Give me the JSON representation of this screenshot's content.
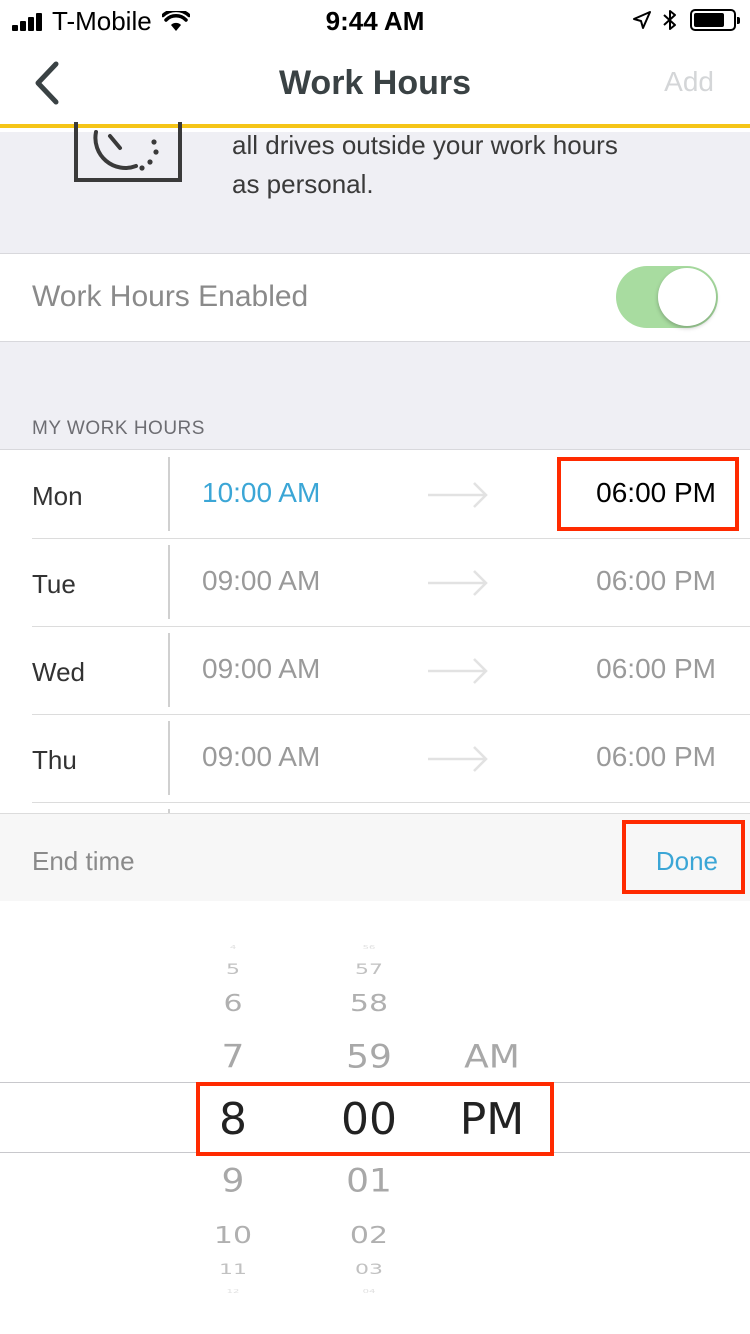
{
  "status_bar": {
    "carrier": "T-Mobile",
    "time": "9:44 AM"
  },
  "nav": {
    "title": "Work Hours",
    "add_label": "Add"
  },
  "intro": {
    "line1": "all drives outside your work hours",
    "line2": "as personal."
  },
  "toggle": {
    "label": "Work Hours Enabled",
    "enabled": true
  },
  "section": {
    "header": "MY WORK HOURS"
  },
  "days": [
    {
      "name": "Mon",
      "start": "10:00 AM",
      "end": "06:00 PM"
    },
    {
      "name": "Tue",
      "start": "09:00 AM",
      "end": "06:00 PM"
    },
    {
      "name": "Wed",
      "start": "09:00 AM",
      "end": "06:00 PM"
    },
    {
      "name": "Thu",
      "start": "09:00 AM",
      "end": "06:00 PM"
    }
  ],
  "picker": {
    "title": "End time",
    "done_label": "Done",
    "hours": [
      "4",
      "5",
      "6",
      "7",
      "8",
      "9",
      "10",
      "11",
      "12"
    ],
    "minutes": [
      "56",
      "57",
      "58",
      "59",
      "00",
      "01",
      "02",
      "03",
      "04"
    ],
    "periods": [
      "AM",
      "PM"
    ],
    "selected": {
      "hour": "8",
      "minute": "00",
      "period": "PM"
    }
  },
  "colors": {
    "accent_blue": "#3ba6d6",
    "nav_underline": "#f5c518",
    "toggle_on": "#a8dca0",
    "highlight_red": "#ff2a00"
  }
}
